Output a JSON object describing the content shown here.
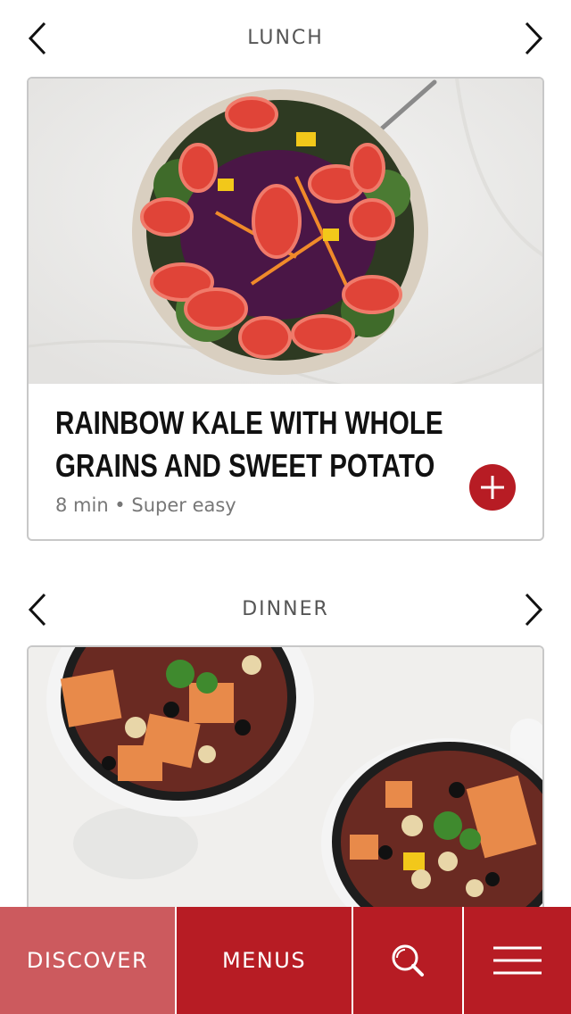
{
  "colors": {
    "accent": "#b71c24",
    "tab_active": "#cc5a5e",
    "tab_default": "#b71c24"
  },
  "lunch": {
    "section_title": "LUNCH",
    "recipe": {
      "title_line1": "RAINBOW KALE WITH WHOLE",
      "title_line2": "GRAINS AND SWEET POTATO",
      "meta": "8 min • Super easy",
      "image": "salad-bowl-photo"
    }
  },
  "dinner": {
    "section_title": "DINNER",
    "recipe": {
      "image": "chili-bowls-photo"
    }
  },
  "tabbar": {
    "discover_label": "DISCOVER",
    "menus_label": "MENUS",
    "search_icon": "search-icon",
    "menu_icon": "hamburger-menu-icon"
  }
}
